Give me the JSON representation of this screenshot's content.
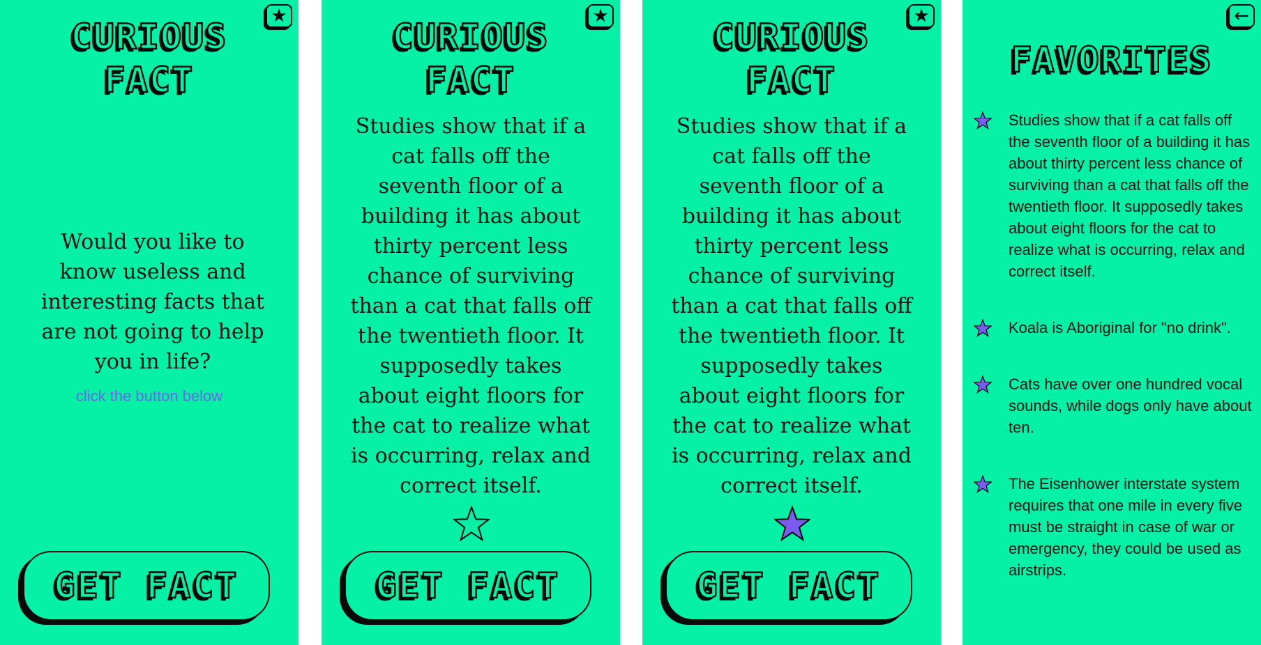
{
  "colors": {
    "background": "#06f0a6",
    "ink": "#0a0a0a",
    "accent_star": "#7b5cf0",
    "hint": "#6a66e8"
  },
  "screens": [
    {
      "title": "CURIOUS\nFACT",
      "corner_icon": "star-icon",
      "intro": "Would you like to know useless and interesting facts that are not going to help you in life?",
      "hint": "click the button below",
      "button_label": "GET FACT"
    },
    {
      "title": "CURIOUS\nFACT",
      "corner_icon": "star-icon",
      "fact": "Studies show that if a cat falls off the seventh floor of a building it has about thirty percent less chance of surviving than a cat that falls off the twentieth floor. It supposedly takes about eight floors for the cat to realize what is occurring, relax and correct itself.",
      "favorite_state": "unfilled",
      "button_label": "GET FACT"
    },
    {
      "title": "CURIOUS\nFACT",
      "corner_icon": "star-icon",
      "fact": "Studies show that if a cat falls off the seventh floor of a building it has about thirty percent less chance of surviving than a cat that falls off the twentieth floor. It supposedly takes about eight floors for the cat to realize what is occurring, relax and correct itself.",
      "favorite_state": "filled",
      "button_label": "GET FACT"
    },
    {
      "title": "FAVORITES",
      "corner_icon": "back-arrow-icon",
      "favorites": [
        "Studies show that if a cat falls off the seventh floor of a building it has about thirty percent less chance of surviving than a cat that falls off the twentieth floor. It supposedly takes about eight floors for the cat to realize what is occurring, relax and correct itself.",
        "Koala is Aboriginal for \"no drink\".",
        "Cats have over one hundred vocal sounds, while dogs only have about ten.",
        "The Eisenhower interstate system requires that one mile in every five must be straight in case of war or emergency, they could be used as airstrips."
      ]
    }
  ]
}
